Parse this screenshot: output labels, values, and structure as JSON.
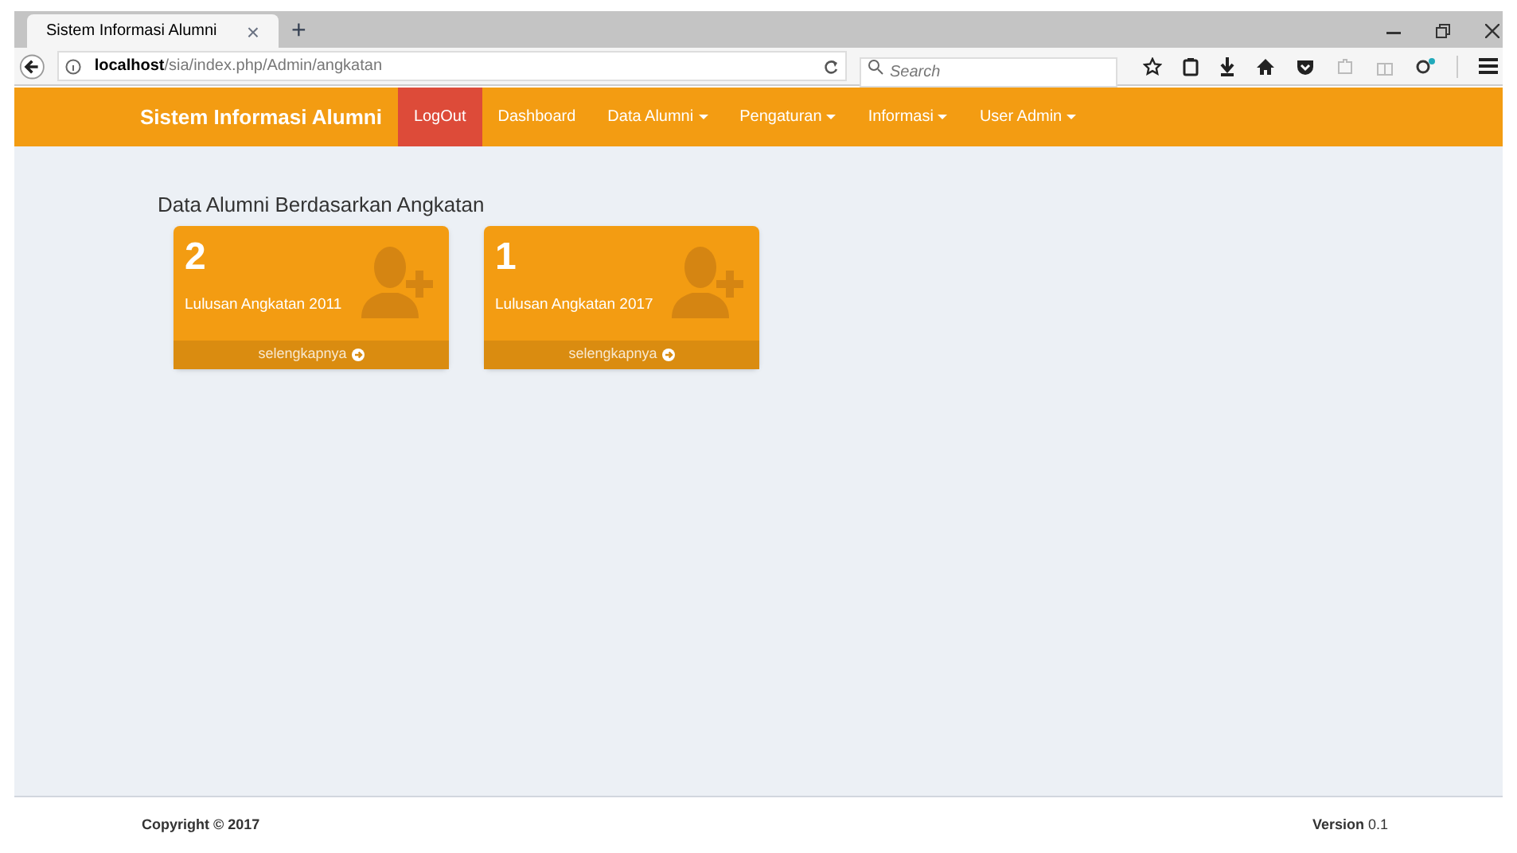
{
  "browser": {
    "tab_title": "Sistem Informasi Alumni",
    "tab_close": "×",
    "new_tab": "+",
    "url_host": "localhost",
    "url_path": "/sia/index.php/Admin/angkatan",
    "search": {
      "placeholder": "Search"
    }
  },
  "navbar": {
    "brand": "Sistem Informasi Alumni",
    "items": [
      {
        "label": "LogOut",
        "kind": "logout"
      },
      {
        "label": "Dashboard",
        "kind": "link"
      },
      {
        "label": "Data Alumni",
        "kind": "dropdown"
      },
      {
        "label": "Pengaturan",
        "kind": "dropdown"
      },
      {
        "label": "Informasi",
        "kind": "dropdown"
      },
      {
        "label": "User Admin",
        "kind": "dropdown"
      }
    ]
  },
  "section_title": "Data Alumni Berdasarkan Angkatan",
  "cards": [
    {
      "count": "2",
      "label": "Lulusan Angkatan 2011",
      "link": "selengkapnya"
    },
    {
      "count": "1",
      "label": "Lulusan Angkatan 2017",
      "link": "selengkapnya"
    }
  ],
  "footer": {
    "copyright": "Copyright © 2017",
    "version": "**Version** 0.1"
  }
}
